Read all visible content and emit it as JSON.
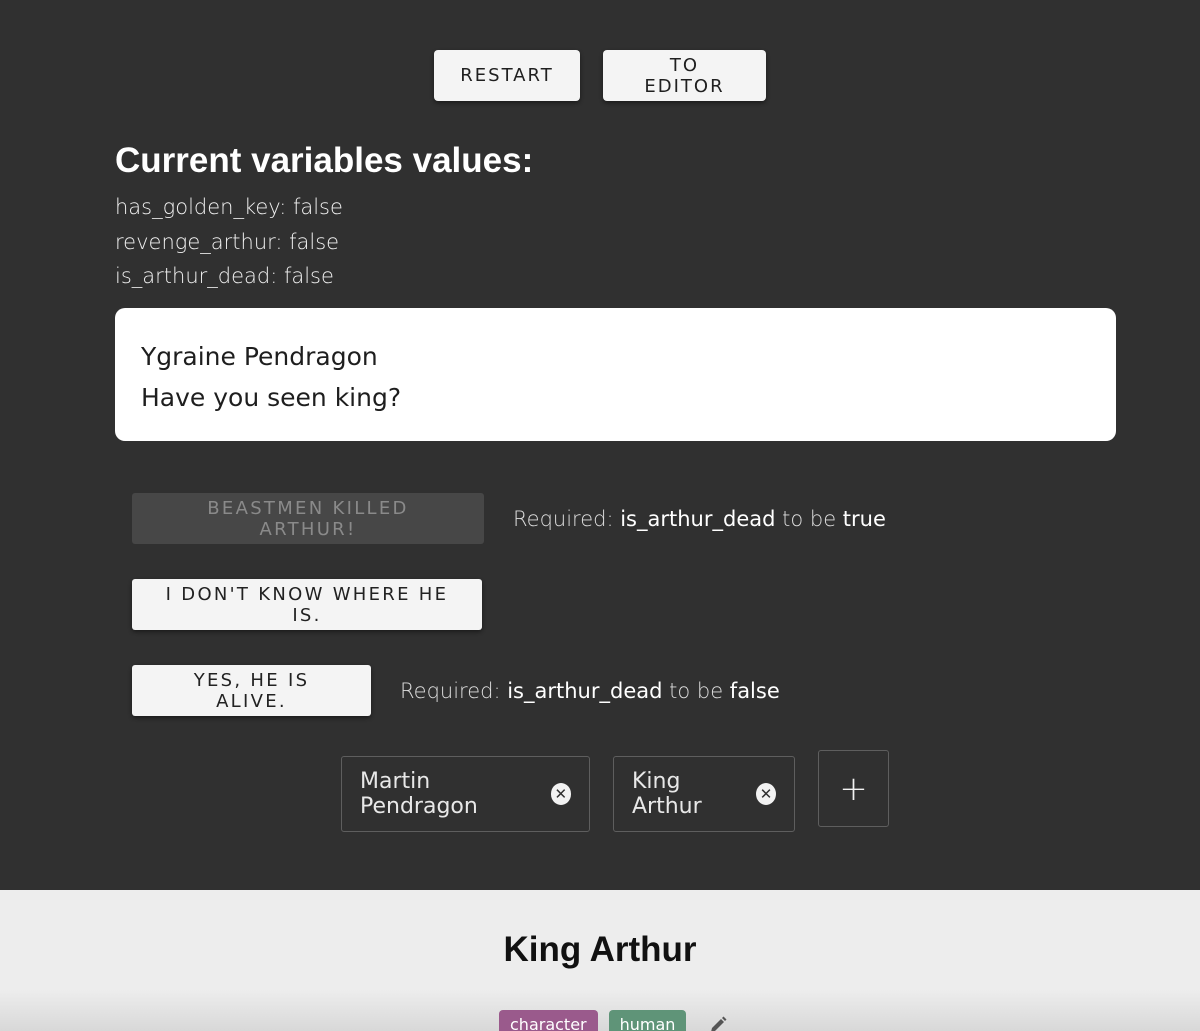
{
  "header": {
    "restart_label": "Restart",
    "editor_label": "To editor"
  },
  "variables": {
    "title": "Current variables values:",
    "items": [
      "has_golden_key: false",
      "revenge_arthur: false",
      "is_arthur_dead: false"
    ]
  },
  "dialog": {
    "speaker": "Ygraine Pendragon",
    "text": "Have you seen king?"
  },
  "choices": [
    {
      "label": "Beastmen killed Arthur!",
      "disabled": true,
      "req_prefix": "Required: ",
      "req_var": "is_arthur_dead",
      "req_mid": " to be ",
      "req_value": "true"
    },
    {
      "label": "I don't know where he is.",
      "disabled": false
    },
    {
      "label": "Yes, he is alive.",
      "disabled": false,
      "req_prefix": "Required: ",
      "req_var": "is_arthur_dead",
      "req_mid": " to be ",
      "req_value": "false"
    }
  ],
  "characters": [
    {
      "name": "Martin Pendragon",
      "remove_icon": "close-circle-icon"
    },
    {
      "name": "King Arthur",
      "remove_icon": "close-circle-icon"
    }
  ],
  "add_button": {
    "label": "+",
    "icon": "plus-icon"
  },
  "detail": {
    "title": "King Arthur",
    "tags": [
      {
        "label": "character",
        "color": "#9a5a8c"
      },
      {
        "label": "human",
        "color": "#5f9478"
      }
    ],
    "edit_icon": "pencil-icon"
  }
}
